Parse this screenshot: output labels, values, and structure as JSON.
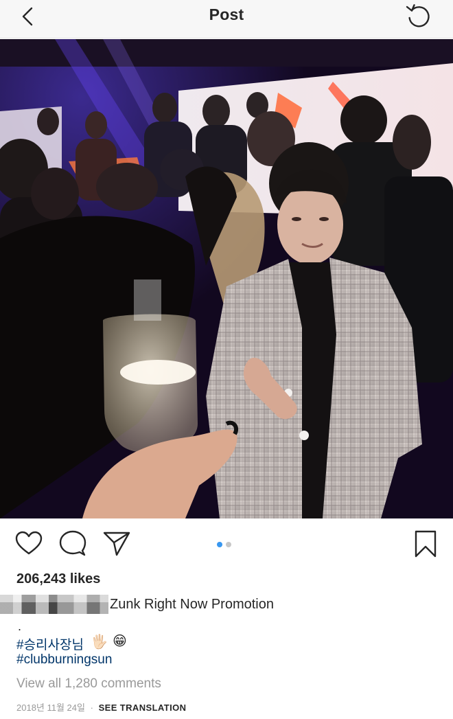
{
  "header": {
    "title": "Post",
    "back_icon": "chevron-left-icon",
    "right_icon": "refresh-icon"
  },
  "post": {
    "carousel": {
      "count": 2,
      "active_index": 0
    },
    "actions": {
      "like_icon": "heart-icon",
      "comment_icon": "comment-icon",
      "share_icon": "send-icon",
      "save_icon": "bookmark-icon"
    },
    "likes": "206,243 likes",
    "caption": {
      "visible_text": "Zunk Right Now Promotion",
      "dot": "."
    },
    "hashtags": [
      "#승리사장님",
      "#clubburningsun"
    ],
    "emojis": [
      "🖐🏻",
      "😁"
    ],
    "view_comments": "View all 1,280 comments",
    "date": "2018년 11월 24일",
    "separator": "·",
    "translate": "SEE TRANSLATION"
  },
  "colors": {
    "link": "#003569",
    "muted": "#999999",
    "text": "#262626",
    "dot_active": "#3897f0"
  }
}
